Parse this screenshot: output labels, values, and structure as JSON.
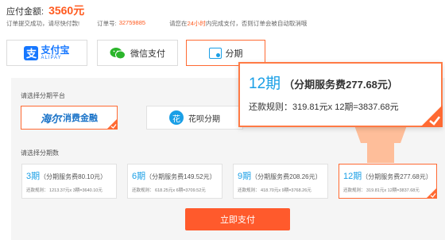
{
  "order": {
    "amount_label": "应付金额:",
    "amount_value": "3560元",
    "notice_1": "订单提交成功，请尽快付款!",
    "order_no_label": "订单号:",
    "order_no": "32759885",
    "notice_2_pre": "请您在",
    "notice_2_highlight": "24小时",
    "notice_2_post": "内完成支付，否则订单会被自动取消哦"
  },
  "payment_methods": [
    {
      "label_cn": "支付宝",
      "label_en": "ALIPAY",
      "icon": "alipay-icon"
    },
    {
      "label": "微信支付",
      "icon": "wechat-icon"
    },
    {
      "label": "分期",
      "icon": "installment-icon",
      "selected": true
    }
  ],
  "platform": {
    "section_label": "请选择分期平台",
    "items": [
      {
        "logo_text": "海尔",
        "label": "消费金融",
        "selected": true
      },
      {
        "label": "花呗分期",
        "icon": "huabei-icon"
      }
    ]
  },
  "terms": {
    "section_label": "请选择分期数",
    "items": [
      {
        "num": "3期",
        "fee": "（分期服务费80.10元）",
        "detail": "还款规则： 1213.37元x 3期=3640.10元"
      },
      {
        "num": "6期",
        "fee": "（分期服务费149.52元）",
        "detail": "还款规则： 618.25元x 6期=3709.52元"
      },
      {
        "num": "9期",
        "fee": "（分期服务费208.26元）",
        "detail": "还款规则： 418.70元x 9期=3768.26元"
      },
      {
        "num": "12期",
        "fee": "（分期服务费277.68元）",
        "detail": "还款规则： 319.81元x 12期=3837.68元",
        "selected": true
      }
    ]
  },
  "callout": {
    "num": "12期",
    "fee": "（分期服务费277.68元）",
    "detail": "还款规则：319.81元x 12期=3837.68元"
  },
  "submit_label": "立即支付",
  "colors": {
    "accent": "#ff5a2c",
    "blue": "#1a9fe6",
    "background": "#f5f5f5"
  }
}
